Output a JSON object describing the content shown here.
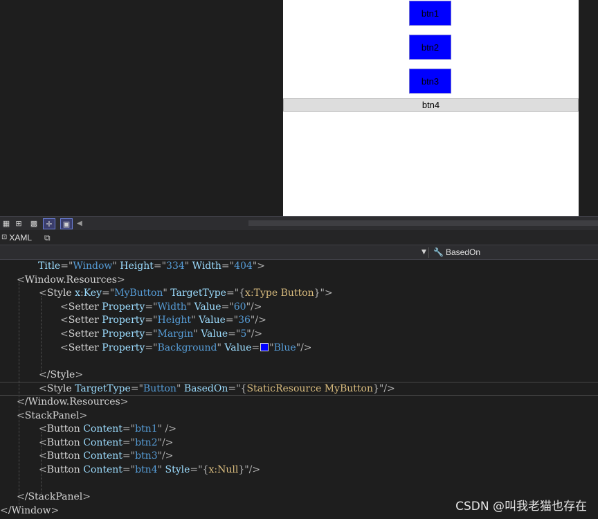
{
  "preview": {
    "buttons": [
      "btn1",
      "btn2",
      "btn3"
    ],
    "btn4": "btn4",
    "button_color": "#0000ff"
  },
  "toolbar": {
    "icons": [
      "grid-icon",
      "snap-grid-icon",
      "checkerboard-icon",
      "snap-lines-icon",
      "annotation-icon"
    ]
  },
  "tabs": {
    "xaml": "XAML"
  },
  "nav": {
    "member": "BasedOn"
  },
  "code": {
    "l1": {
      "a1": "Title",
      "v1": "Window",
      "a2": "Height",
      "v2": "334",
      "a3": "Width",
      "v3": "404"
    },
    "l2": {
      "tag": "Window.Resources"
    },
    "l3": {
      "tag": "Style",
      "a1": "x",
      "a1b": "Key",
      "v1": "MyButton",
      "a2": "TargetType",
      "e1": "x",
      "e1b": ":Type Button"
    },
    "l4": {
      "tag": "Setter",
      "a1": "Property",
      "v1": "Width",
      "a2": "Value",
      "v2": "60"
    },
    "l5": {
      "tag": "Setter",
      "a1": "Property",
      "v1": "Height",
      "a2": "Value",
      "v2": "36"
    },
    "l6": {
      "tag": "Setter",
      "a1": "Property",
      "v1": "Margin",
      "a2": "Value",
      "v2": "5"
    },
    "l7": {
      "tag": "Setter",
      "a1": "Property",
      "v1": "Background",
      "a2": "Value",
      "v2": "Blue"
    },
    "l9": {
      "tag": "/Style"
    },
    "l10": {
      "tag": "Style",
      "a1": "TargetType",
      "v1": "Button",
      "a2": "BasedOn",
      "e1": "StaticResource",
      "e2": "MyButton"
    },
    "l11": {
      "tag": "/Window.Resources"
    },
    "l12": {
      "tag": "StackPanel"
    },
    "l13": {
      "tag": "Button",
      "a1": "Content",
      "v1": "btn1"
    },
    "l14": {
      "tag": "Button",
      "a1": "Content",
      "v1": "btn2"
    },
    "l15": {
      "tag": "Button",
      "a1": "Content",
      "v1": "btn3"
    },
    "l16": {
      "tag": "Button",
      "a1": "Content",
      "v1": "btn4",
      "a2": "Style",
      "e1": "x:Null"
    },
    "l18": {
      "tag": "/StackPanel"
    },
    "l19": {
      "tag": "/Window"
    }
  },
  "watermark": "CSDN @叫我老猫也存在"
}
